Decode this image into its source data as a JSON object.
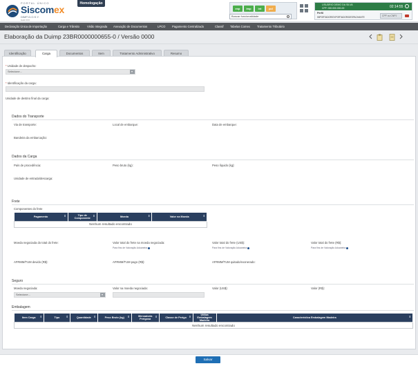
{
  "header": {
    "portal_label": "PORTAL ÚNICO",
    "brand_main": "Siscom",
    "brand_accent": "ex",
    "brand_sub": "DIMP-D.O.S.Y.",
    "build": "build XXX",
    "env_badge": "Homologação",
    "modules": [
      "exp",
      "imp",
      "int",
      "pcl"
    ],
    "search_placeholder": "Buscar funcionalidade",
    "user_name": "USUÁRIO DEMO DA SILVA",
    "user_cpf": "CPF: 000.000.000-00",
    "timer": "02:14:55",
    "perfil_label": "Perfil",
    "perfil_value": "IMPORTADOR/EXPORTADOR/DESPACHANTE",
    "perfil_select": "CPF ou CNPJ"
  },
  "nav": {
    "items": [
      "Declaração Única de Importação",
      "Carga e Trânsito",
      "Visão Integrada",
      "Anexação de Documentos",
      "LPCO",
      "Pagamento Centralizado",
      "Classif",
      "Tabelas Comex",
      "Tratamento Tributário"
    ]
  },
  "page": {
    "title": "Elaboração da Duimp 23BR0000000655-0 / Versão 0000"
  },
  "tabs": [
    "Identificação",
    "Carga",
    "Documentos",
    "Item",
    "Tratamento Administrativo",
    "Resumo"
  ],
  "form": {
    "unidade_despacho_label": "Unidade de despacho:",
    "unidade_despacho_value": "Selecione...",
    "identificacao_carga_label": "Identificação da carga:",
    "unidade_destino_label": "Unidade de destino final da carga:",
    "dados_transporte": {
      "title": "Dados do Transporte",
      "via": "Via de transporte:",
      "local": "Local de embarque:",
      "data": "Data de embarque:",
      "bandeira": "Bandeira da embarcação:"
    },
    "dados_carga": {
      "title": "Dados da Carga",
      "pais": "País de procedência:",
      "peso_bruto": "Peso bruto (kg):",
      "peso_liquido": "Peso líquido (kg):",
      "unidade_entrada": "Unidade de entrada/descarga:"
    },
    "frete": {
      "title": "Frete",
      "componentes": "Componentes do frete",
      "cols": [
        "Pagamento",
        "Tipo de Componente",
        "Moeda",
        "Valor na Moeda"
      ],
      "empty": "Nenhum resultado encontrado",
      "moeda_total": "Moeda negociada do total do frete:",
      "valor_moeda": "Valor total do frete na moeda negociada:",
      "valor_usd": "Valor total do frete (US$):",
      "valor_rs": "Valor total do frete (R$):",
      "hint": "Para fins de Valoração Aduaneira",
      "afrmm_devido": "AFRMM/TUM devido (R$):",
      "afrmm_pago": "AFRMM/TUM pago (R$):",
      "afrmm_quitado": "AFRMM/TUM quitado/exonerado:"
    },
    "seguro": {
      "title": "Seguro",
      "moeda": "Moeda negociada:",
      "moeda_value": "Selecione...",
      "valor_moeda": "Valor na moeda negociada:",
      "valor_usd": "Valor (US$):",
      "valor_rs": "Valor (R$):"
    },
    "embalagem": {
      "title": "Embalagem",
      "cols": [
        "Item Carga",
        "Tipo",
        "Quantidade",
        "Peso Bruto (kg)",
        "Mercadoria Perigosa",
        "Classe de Perigo",
        "Utiliza Embalagem Madeira",
        "Característica Embalagem Madeira"
      ],
      "empty": "Nenhum resultado encontrado"
    }
  },
  "footer": {
    "save": "Salvar"
  },
  "colors": {
    "nav": "#53565a",
    "table_header": "#2a3f5f",
    "save": "#1f6fb5",
    "brand": "#1e4b7a",
    "brand_accent": "#f28c28"
  }
}
